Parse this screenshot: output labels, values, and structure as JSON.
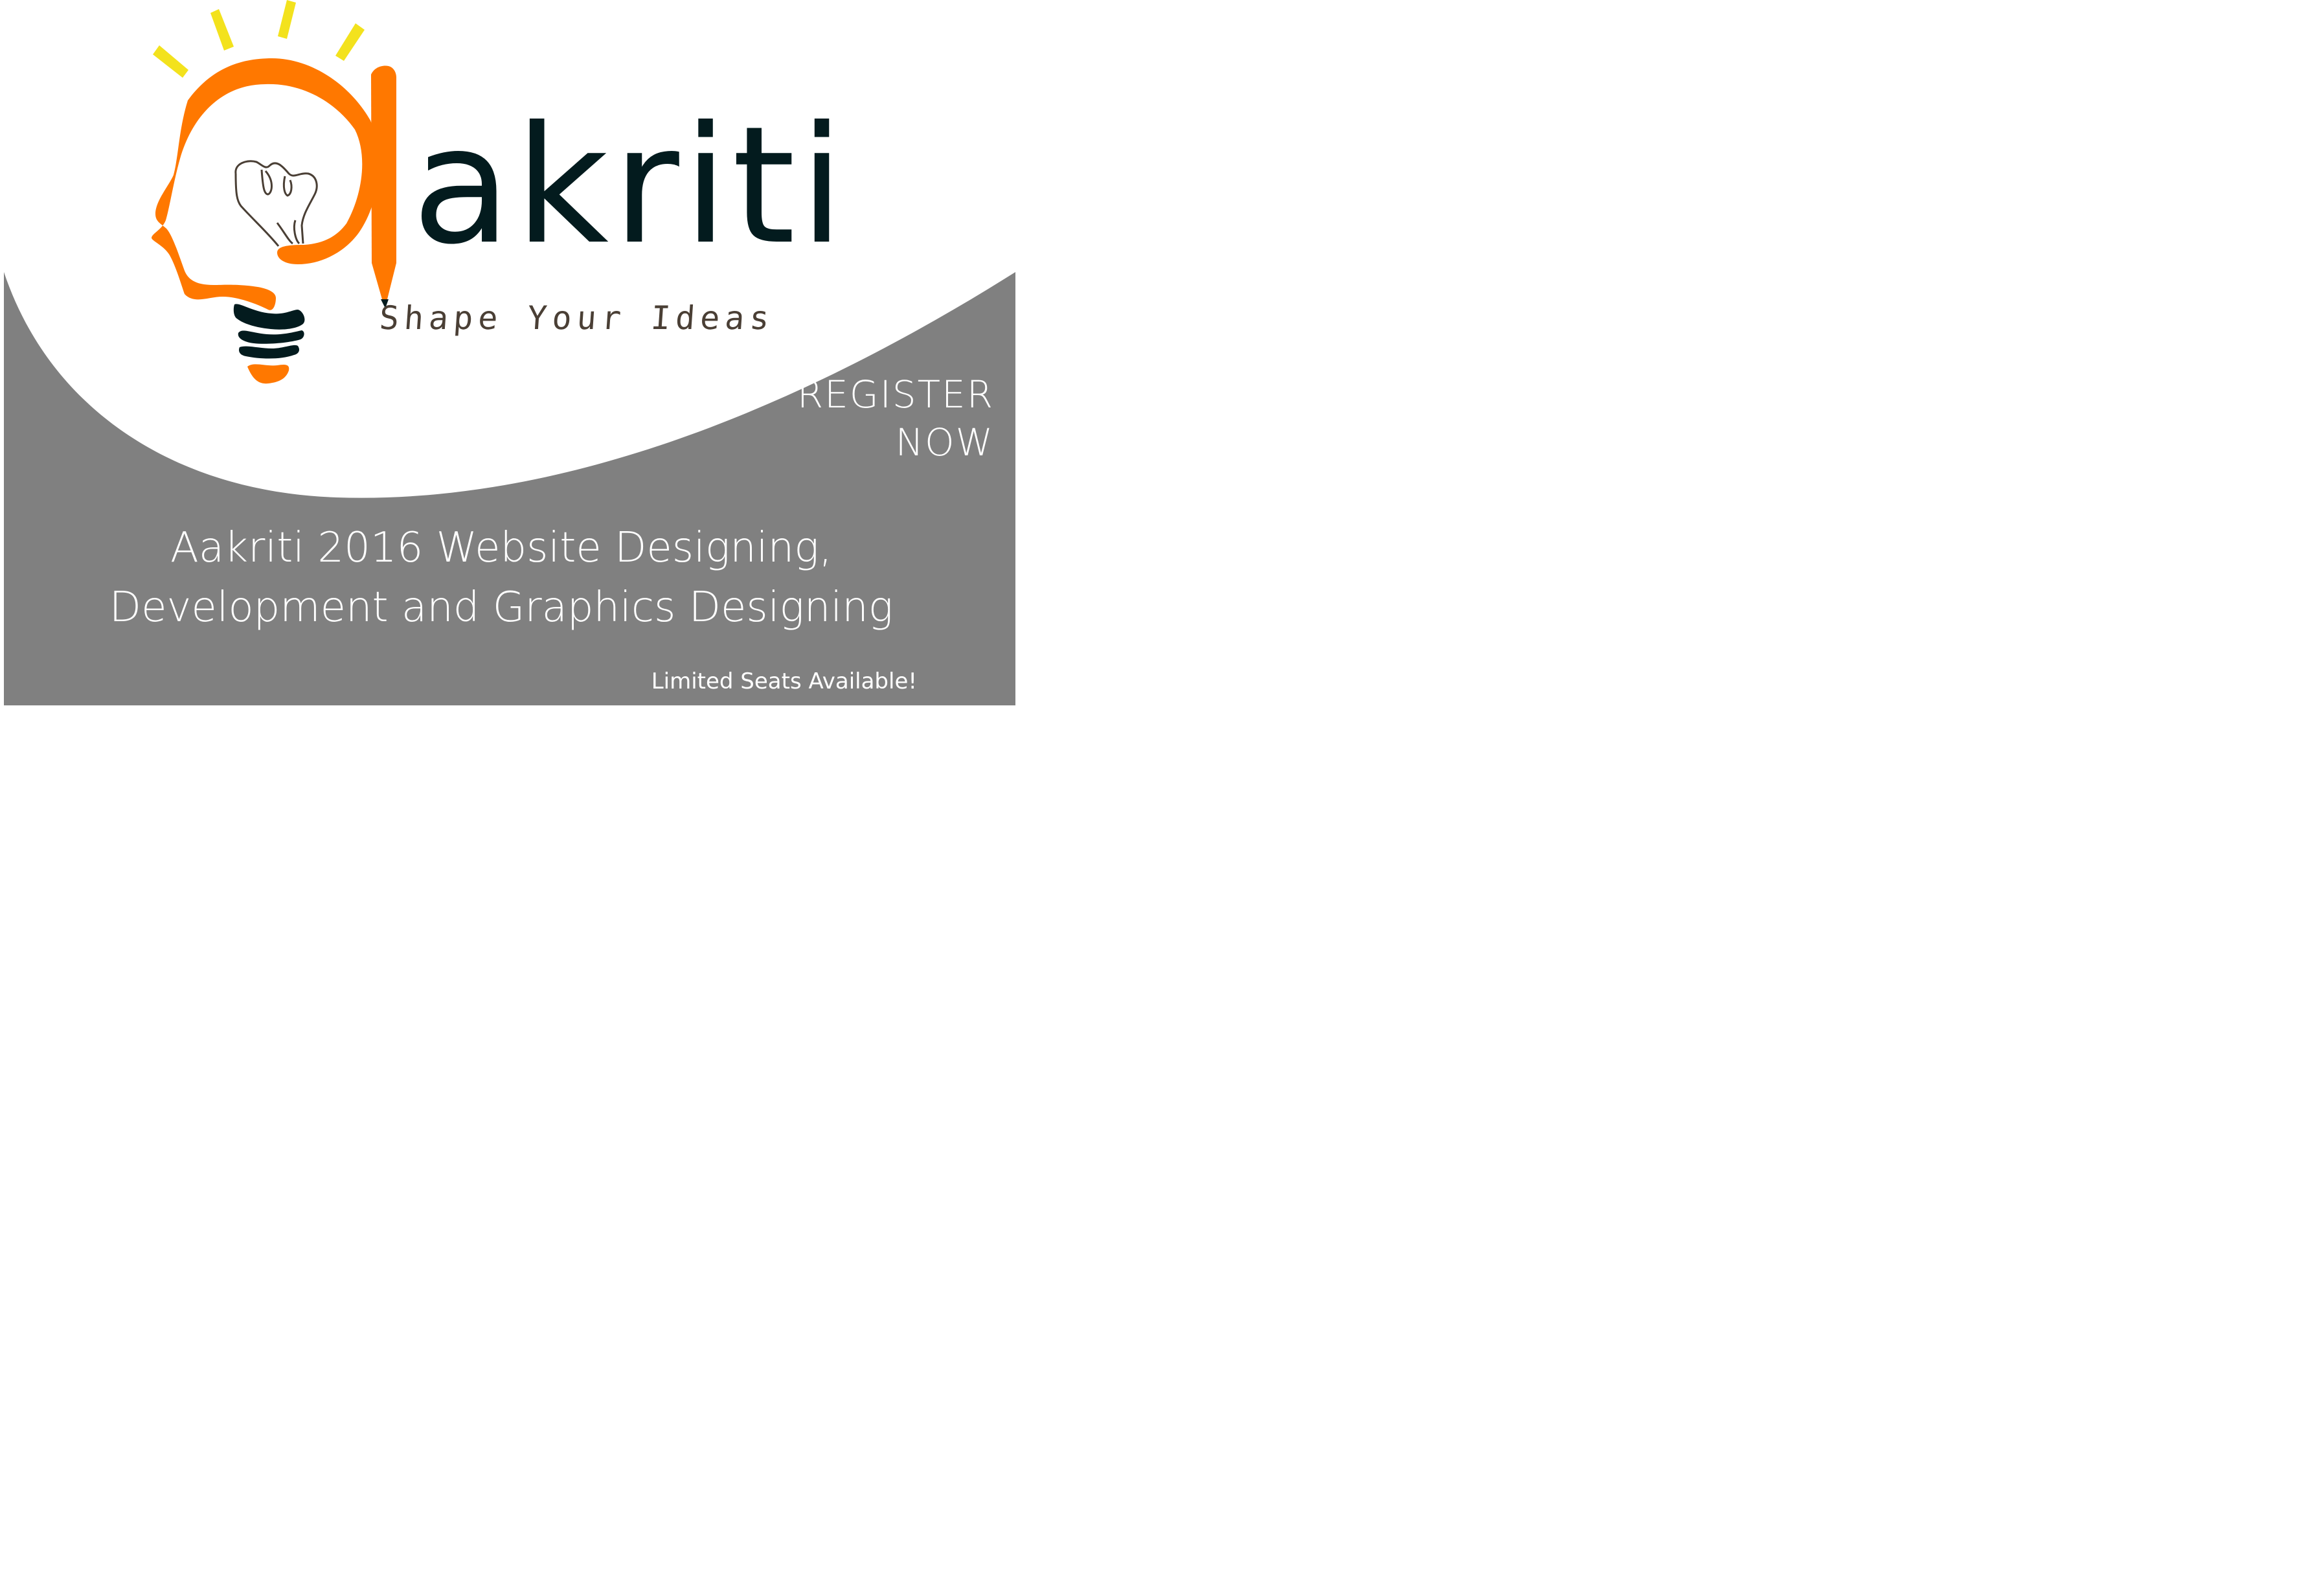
{
  "brand": {
    "wordmark": "akriti",
    "tagline": "Shape Your Ideas"
  },
  "cta": {
    "line1": "REGISTER",
    "line2": "NOW"
  },
  "headline": {
    "line1": "Aakriti 2016 Website Designing,",
    "line2": "Development and Graphics Designing"
  },
  "note": "Limited Seats Available!",
  "colors": {
    "orange": "#ff7800",
    "yellow": "#f3e21d",
    "dark": "#031b1e",
    "gray": "#808080",
    "brown": "#4a3f35"
  },
  "icons": [
    "lightbulb-head-icon",
    "pencil-icon",
    "brain-icon"
  ]
}
